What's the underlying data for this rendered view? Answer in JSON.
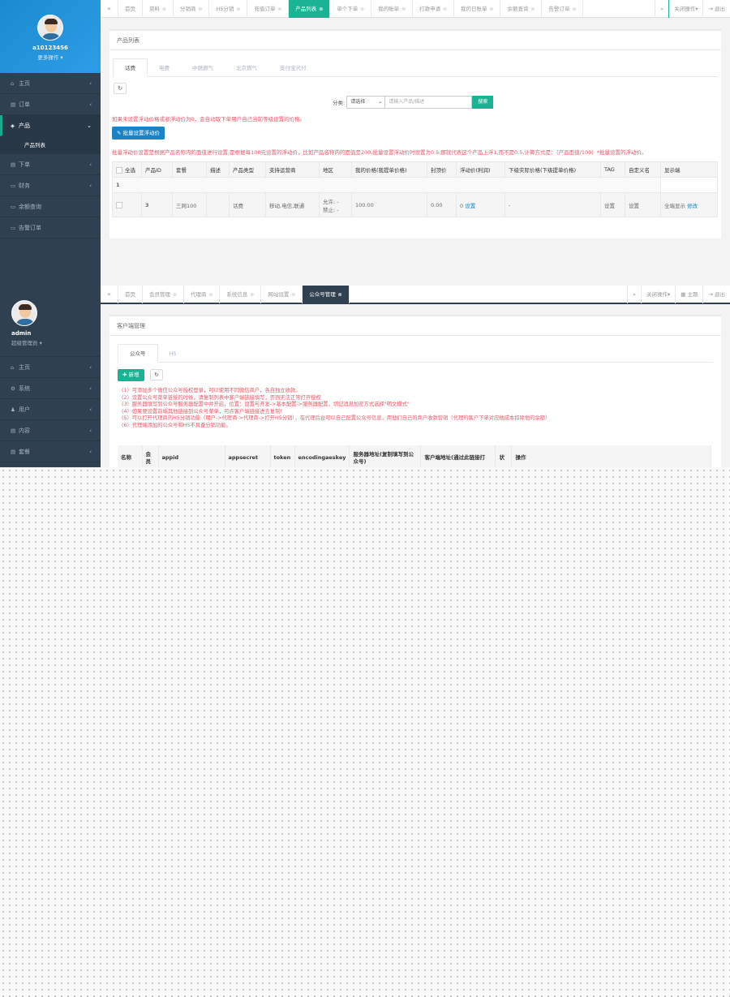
{
  "shot1": {
    "user": {
      "name": "a10123456",
      "more": "更多操作"
    },
    "nav": [
      {
        "icon": "home-icon",
        "glyph": "⌂",
        "label": "主页",
        "arrow": "‹"
      },
      {
        "icon": "order-icon",
        "glyph": "▤",
        "label": "订单",
        "arrow": "‹"
      },
      {
        "icon": "product-icon",
        "glyph": "◈",
        "label": "产品",
        "arrow": "⌄"
      },
      {
        "icon": "place-order-icon",
        "glyph": "▤",
        "label": "下单",
        "arrow": "‹"
      },
      {
        "icon": "finance-icon",
        "glyph": "▭",
        "label": "财务",
        "arrow": "‹"
      },
      {
        "icon": "balance-icon",
        "glyph": "▭",
        "label": "余额查询",
        "arrow": ""
      },
      {
        "icon": "alert-icon",
        "glyph": "▭",
        "label": "告警订单",
        "arrow": ""
      }
    ],
    "nav_sub": "产品列表",
    "tabs": [
      "首页",
      "资料",
      "分销商",
      "H5分销",
      "充值订单",
      "产品列表",
      "单个下单",
      "我的账单",
      "打款申请",
      "我的日账单",
      "余额查询",
      "告警订单"
    ],
    "tabs_closable": [
      false,
      true,
      true,
      true,
      true,
      true,
      true,
      true,
      true,
      true,
      true,
      true
    ],
    "tab_active": 5,
    "close_ops": "关闭操作",
    "logout": "退出",
    "panel_title": "产品列表",
    "subtabs": [
      "话费",
      "电费",
      "中燃燃气",
      "北京燃气",
      "支付宝代付"
    ],
    "filter": {
      "label": "分类:",
      "select": "请选择",
      "placeholder": "请输入产品/描述",
      "search": "搜索"
    },
    "warn1": "如果未设置浮动价格或者浮动价为0，会自动取下单用户自己当前等级设置的价格。",
    "batch_btn": "批量设置浮动价",
    "warn2": "批量浮动价设置是根据产品名称内的面值进行设置,是根据每100元设置的浮动价，比如产品名称内的面值是200,批量设置浮动价时设置为0.5,那就代表这个产品上浮1,而不是0.5,计算方式是：（产品面值/100）*批量设置的浮动价。",
    "table_headers": [
      "全选",
      "产品ID",
      "套餐",
      "描述",
      "产品类型",
      "支持运营商",
      "地区",
      "我的价格(我提单价格)",
      "封顶价",
      "浮动价(利润)",
      "下级实际价格(下级提单价格)",
      "TAG",
      "自定义名",
      "显示端"
    ],
    "group": "1",
    "row": {
      "id": "3",
      "package": "三网100",
      "desc": "",
      "type": "话费",
      "carriers": "移动,电信,联通",
      "allow": "允许: -",
      "forbid": "禁止: -",
      "my_price": "100.00",
      "cap": "0.00",
      "float_val": "0",
      "float_link": "设置",
      "lower_price": "-",
      "tag": "设置",
      "custom": "设置",
      "display": "全端显示",
      "display_link": "修改"
    }
  },
  "shot2": {
    "user": {
      "name": "admin",
      "role": "超级管理员"
    },
    "nav": [
      {
        "icon": "home-icon",
        "glyph": "⌂",
        "label": "主页",
        "arrow": "‹"
      },
      {
        "icon": "system-icon",
        "glyph": "⚙",
        "label": "系统",
        "arrow": "‹"
      },
      {
        "icon": "users-icon",
        "glyph": "♟",
        "label": "用户",
        "arrow": "‹"
      },
      {
        "icon": "content-icon",
        "glyph": "▤",
        "label": "内容",
        "arrow": "‹"
      },
      {
        "icon": "package-icon",
        "glyph": "▤",
        "label": "套餐",
        "arrow": "‹"
      }
    ],
    "tabs": [
      "首页",
      "会员管理",
      "代理商",
      "系统信息",
      "网站设置",
      "公众号管理"
    ],
    "tabs_closable": [
      false,
      true,
      true,
      true,
      true,
      true
    ],
    "tab_active": 5,
    "close_ops": "关闭操作",
    "theme": "主题",
    "logout": "退出",
    "panel_title": "客户端管理",
    "subtabs": [
      "公众号",
      "H5"
    ],
    "add_btn": "新增",
    "notes": [
      "(1）可添加多个微信公众号授权登录，可以使用不同微信商户，各自独立收款。",
      "(2）设置公众号菜单链接的时候，请复制列表中客户端链接填写，否则无法正常打开授权",
      "(3）服务器填写到公众号服务器配置中并开启，位置：设置与开发->基本配置->服务器配置，切记消息加密方式选择\"明文模式\"",
      "(4）如果要设置前端其他链接到公众号菜单，可点客户端链接进去复制!",
      "(5）可以打开代理商的H5分销功能（用户->代理商->代理商->打开H5分销），在代理后台可以自己配置公众号信息，用他们自己的商户收款营销（代理的客户下单对应他成本扣除他的余额）",
      "(6）代理端添加的公众号和H5不具备分销功能。"
    ],
    "table_headers": [
      "名称",
      "会员",
      "appid",
      "appsecret",
      "token",
      "encodingaeskey",
      "服务器地址(复制填写到公众号)",
      "客户端地址(通过此链接打",
      "状",
      "操作"
    ]
  }
}
